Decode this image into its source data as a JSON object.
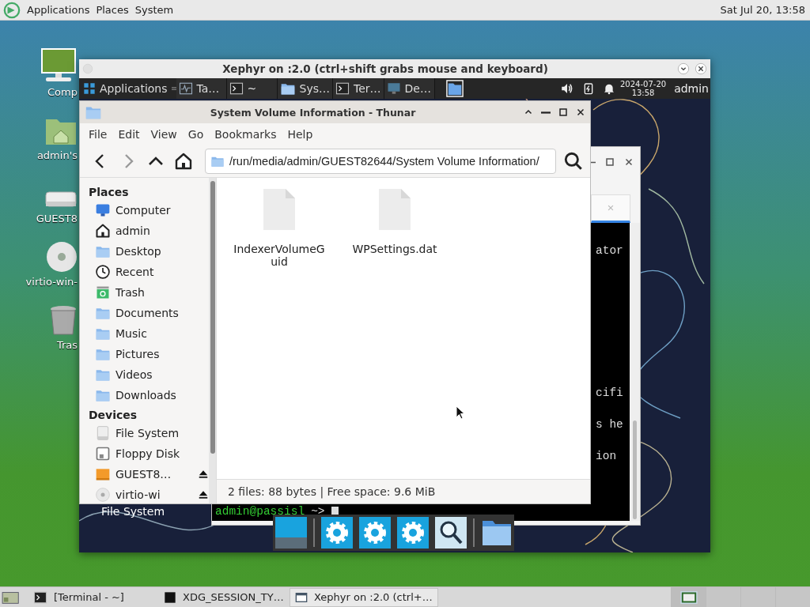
{
  "top_panel": {
    "menus": [
      "Applications",
      "Places",
      "System"
    ],
    "clock": "Sat Jul 20, 13:58"
  },
  "desktop_icons": [
    {
      "kind": "computer",
      "label": "Comp"
    },
    {
      "kind": "home",
      "label": "admin's"
    },
    {
      "kind": "drive",
      "label": "GUEST8"
    },
    {
      "kind": "disc",
      "label": "virtio-win-"
    },
    {
      "kind": "trash",
      "label": "Tras"
    }
  ],
  "xephyr": {
    "title": "Xephyr on :2.0 (ctrl+shift grabs mouse and keyboard)",
    "panel": {
      "menu": "Applications",
      "tasks": [
        {
          "kind": "activity",
          "label": "Ta…"
        },
        {
          "kind": "terminal",
          "label": "~"
        },
        {
          "kind": "folder",
          "label": "Sys…"
        },
        {
          "kind": "terminal",
          "label": "Ter…"
        },
        {
          "kind": "display",
          "label": "De…"
        }
      ],
      "date": "2024-07-20",
      "time": "13:58",
      "user": "admin"
    },
    "desktop_label": "File System",
    "terminal": {
      "lines": [
        "ator",
        "cifi",
        "s he",
        "ion"
      ],
      "prompt_host": "admin@passisl",
      "prompt_symbol": "~>"
    },
    "thunar": {
      "title": "System Volume Information - Thunar",
      "menu": [
        "File",
        "Edit",
        "View",
        "Go",
        "Bookmarks",
        "Help"
      ],
      "path": "/run/media/admin/GUEST82644/System Volume Information/",
      "sidebar": [
        {
          "title": "Places",
          "items": [
            {
              "kind": "computer",
              "label": "Computer"
            },
            {
              "kind": "home",
              "label": "admin"
            },
            {
              "kind": "folder",
              "label": "Desktop"
            },
            {
              "kind": "clock",
              "label": "Recent"
            },
            {
              "kind": "trash",
              "label": "Trash"
            },
            {
              "kind": "folder",
              "label": "Documents"
            },
            {
              "kind": "folder",
              "label": "Music"
            },
            {
              "kind": "folder",
              "label": "Pictures"
            },
            {
              "kind": "folder",
              "label": "Videos"
            },
            {
              "kind": "folder",
              "label": "Downloads"
            }
          ]
        },
        {
          "title": "Devices",
          "items": [
            {
              "kind": "drive",
              "label": "File System",
              "eject": false
            },
            {
              "kind": "floppy",
              "label": "Floppy Disk",
              "eject": false
            },
            {
              "kind": "usb",
              "label": "GUEST8…",
              "eject": true
            },
            {
              "kind": "disc",
              "label": "virtio-wi",
              "eject": true
            }
          ]
        }
      ],
      "files": [
        {
          "name": "IndexerVolumeGuid"
        },
        {
          "name": "WPSettings.dat"
        }
      ],
      "status": "2 files: 88 bytes | Free space: 9.6 MiB"
    },
    "dock": [
      {
        "kind": "screen"
      },
      {
        "kind": "separator"
      },
      {
        "kind": "gear"
      },
      {
        "kind": "gear"
      },
      {
        "kind": "gear"
      },
      {
        "kind": "magnifier"
      },
      {
        "kind": "separator"
      },
      {
        "kind": "folder"
      }
    ]
  },
  "taskbar": {
    "tasks": [
      {
        "kind": "terminal",
        "label": "[Terminal - ~]",
        "selected": false
      },
      {
        "kind": "console",
        "label": "XDG_SESSION_TY…",
        "selected": false
      },
      {
        "kind": "window",
        "label": "Xephyr on :2.0 (ctrl+…",
        "selected": true
      }
    ],
    "workspaces": [
      {
        "selected": true
      },
      {
        "selected": false
      },
      {
        "selected": false
      },
      {
        "selected": false
      }
    ]
  }
}
